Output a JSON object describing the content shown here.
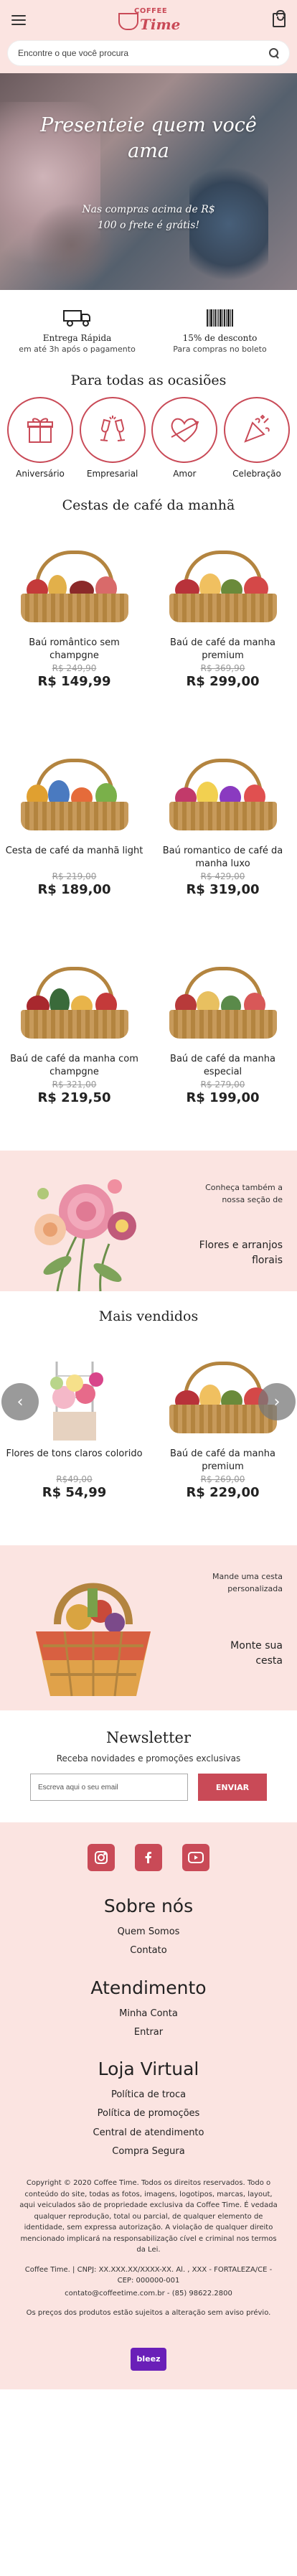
{
  "header": {
    "logo_top": "COFFEE",
    "logo_bottom": "Time",
    "search_placeholder": "Encontre o que você procura"
  },
  "hero": {
    "title": "Presenteie quem você ama",
    "subtitle": "Nas compras acima de R$ 100 o frete é grátis!"
  },
  "features": [
    {
      "title": "Entrega Rápida",
      "subtitle": "em até 3h após o pagamento",
      "icon": "truck-icon"
    },
    {
      "title": "15% de desconto",
      "subtitle": "Para compras no boleto",
      "icon": "barcode-icon"
    }
  ],
  "occasions": {
    "title": "Para todas as ocasiões",
    "items": [
      {
        "label": "Aniversário",
        "icon": "gift-icon"
      },
      {
        "label": "Empresarial",
        "icon": "champagne-icon"
      },
      {
        "label": "Amor",
        "icon": "heart-icon"
      },
      {
        "label": "Celebração",
        "icon": "party-icon"
      }
    ]
  },
  "breakfast": {
    "title": "Cestas de café da manhã",
    "products": [
      {
        "name": "Baú romântico sem champgne",
        "old_price": "R$ 249,90",
        "price": "R$ 149,99"
      },
      {
        "name": "Baú de café da manha premium",
        "old_price": "R$ 369,90",
        "price": "R$ 299,00"
      },
      {
        "name": "Cesta de café da manhã light",
        "old_price": "R$ 219,00",
        "price": "R$ 189,00"
      },
      {
        "name": "Baú romantico de café da manha luxo",
        "old_price": "R$ 429,00",
        "price": "R$ 319,00"
      },
      {
        "name": "Baú de café da manha com champgne",
        "old_price": "R$ 321,00",
        "price": "R$ 219,50"
      },
      {
        "name": "Baú de café da manha especial",
        "old_price": "R$ 279,00",
        "price": "R$ 199,00"
      }
    ]
  },
  "flowers_banner": {
    "text": "Conheça também a nossa seção de",
    "highlight": "Flores e arranjos florais"
  },
  "bestsellers": {
    "title": "Mais vendidos",
    "prev": "‹",
    "next": "›",
    "products": [
      {
        "name": "Flores de tons claros colorido",
        "old_price": "R$49,00",
        "price": "R$ 54,99"
      },
      {
        "name": "Baú de café da manha premium",
        "old_price": "R$ 269,00",
        "price": "R$ 229,00"
      }
    ]
  },
  "custom_banner": {
    "text": "Mande uma cesta personalizada",
    "highlight": "Monte sua cesta"
  },
  "newsletter": {
    "title": "Newsletter",
    "subtitle": "Receba novidades e promoções exclusivas",
    "placeholder": "Escreva aqui o seu email",
    "button": "ENVIAR"
  },
  "footer": {
    "sections": [
      {
        "title": "Sobre nós",
        "links": [
          "Quem Somos",
          "Contato"
        ]
      },
      {
        "title": "Atendimento",
        "links": [
          "Minha Conta",
          "Entrar"
        ]
      },
      {
        "title": "Loja Virtual",
        "links": [
          "Política de troca",
          "Política de promoções",
          "Central de atendimento",
          "Compra Segura"
        ]
      }
    ],
    "copyright": "Copyright © 2020 Coffee Time. Todos os direitos reservados. Todo o conteúdo do site, todas as fotos, imagens, logotipos, marcas, layout, aqui veiculados são de propriedade exclusiva da Coffee Time. É vedada qualquer reprodução, total ou parcial, de qualquer elemento de identidade, sem expressa autorização. A violação de qualquer direito mencionado implicará na responsabilização cível e criminal nos termos da Lei.",
    "company": "Coffee Time. | CNPJ: XX.XXX.XX/XXXX-XX. Al. , XXX - FORTALEZA/CE - CEP: 000000-001",
    "contact": "contato@coffeetime.com.br - (85) 98622.2800",
    "disclaimer": "Os preços dos produtos estão sujeitos a alteração sem aviso prévio.",
    "badge": "bleez"
  },
  "colors": {
    "accent": "#c94a57",
    "pink_bg": "#fbe4e1"
  }
}
